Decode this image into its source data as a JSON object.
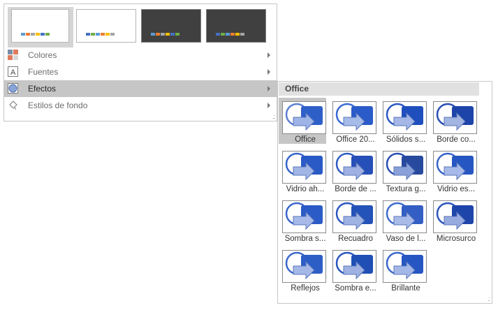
{
  "variants": [
    {
      "name": "variant-1",
      "theme": "light",
      "selected": true
    },
    {
      "name": "variant-2",
      "theme": "light",
      "selected": false
    },
    {
      "name": "variant-3",
      "theme": "dark",
      "selected": false
    },
    {
      "name": "variant-4",
      "theme": "dark",
      "selected": false
    }
  ],
  "swatches_a": [
    "#5b9bd5",
    "#ed7d31",
    "#a5a5a5",
    "#ffc000",
    "#4472c4",
    "#70ad47"
  ],
  "swatches_b": [
    "#4472c4",
    "#70ad47",
    "#5b9bd5",
    "#ed7d31",
    "#ffc000",
    "#a5a5a5"
  ],
  "menu": {
    "items": [
      {
        "label": "Colores",
        "icon": "color-squares-icon"
      },
      {
        "label": "Fuentes",
        "icon": "font-a-icon"
      },
      {
        "label": "Efectos",
        "icon": "effects-circle-icon"
      },
      {
        "label": "Estilos de fondo",
        "icon": "paint-bucket-icon"
      }
    ]
  },
  "flyout": {
    "header": "Office",
    "tiles": [
      {
        "label": "Office",
        "selected": true
      },
      {
        "label": "Office 20..."
      },
      {
        "label": "Sólidos s..."
      },
      {
        "label": "Borde co..."
      },
      {
        "label": "Vidrio ah..."
      },
      {
        "label": "Borde de ..."
      },
      {
        "label": "Textura g..."
      },
      {
        "label": "Vidrio es..."
      },
      {
        "label": "Sombra s..."
      },
      {
        "label": "Recuadro"
      },
      {
        "label": "Vaso de l..."
      },
      {
        "label": "Microsurco"
      },
      {
        "label": "Reflejos"
      },
      {
        "label": "Sombra e..."
      },
      {
        "label": "Brillante"
      }
    ]
  },
  "colors": {
    "accent": "#4472c4",
    "selected_bg": "#c6c6c6",
    "header_bg": "#e1e1e1"
  }
}
